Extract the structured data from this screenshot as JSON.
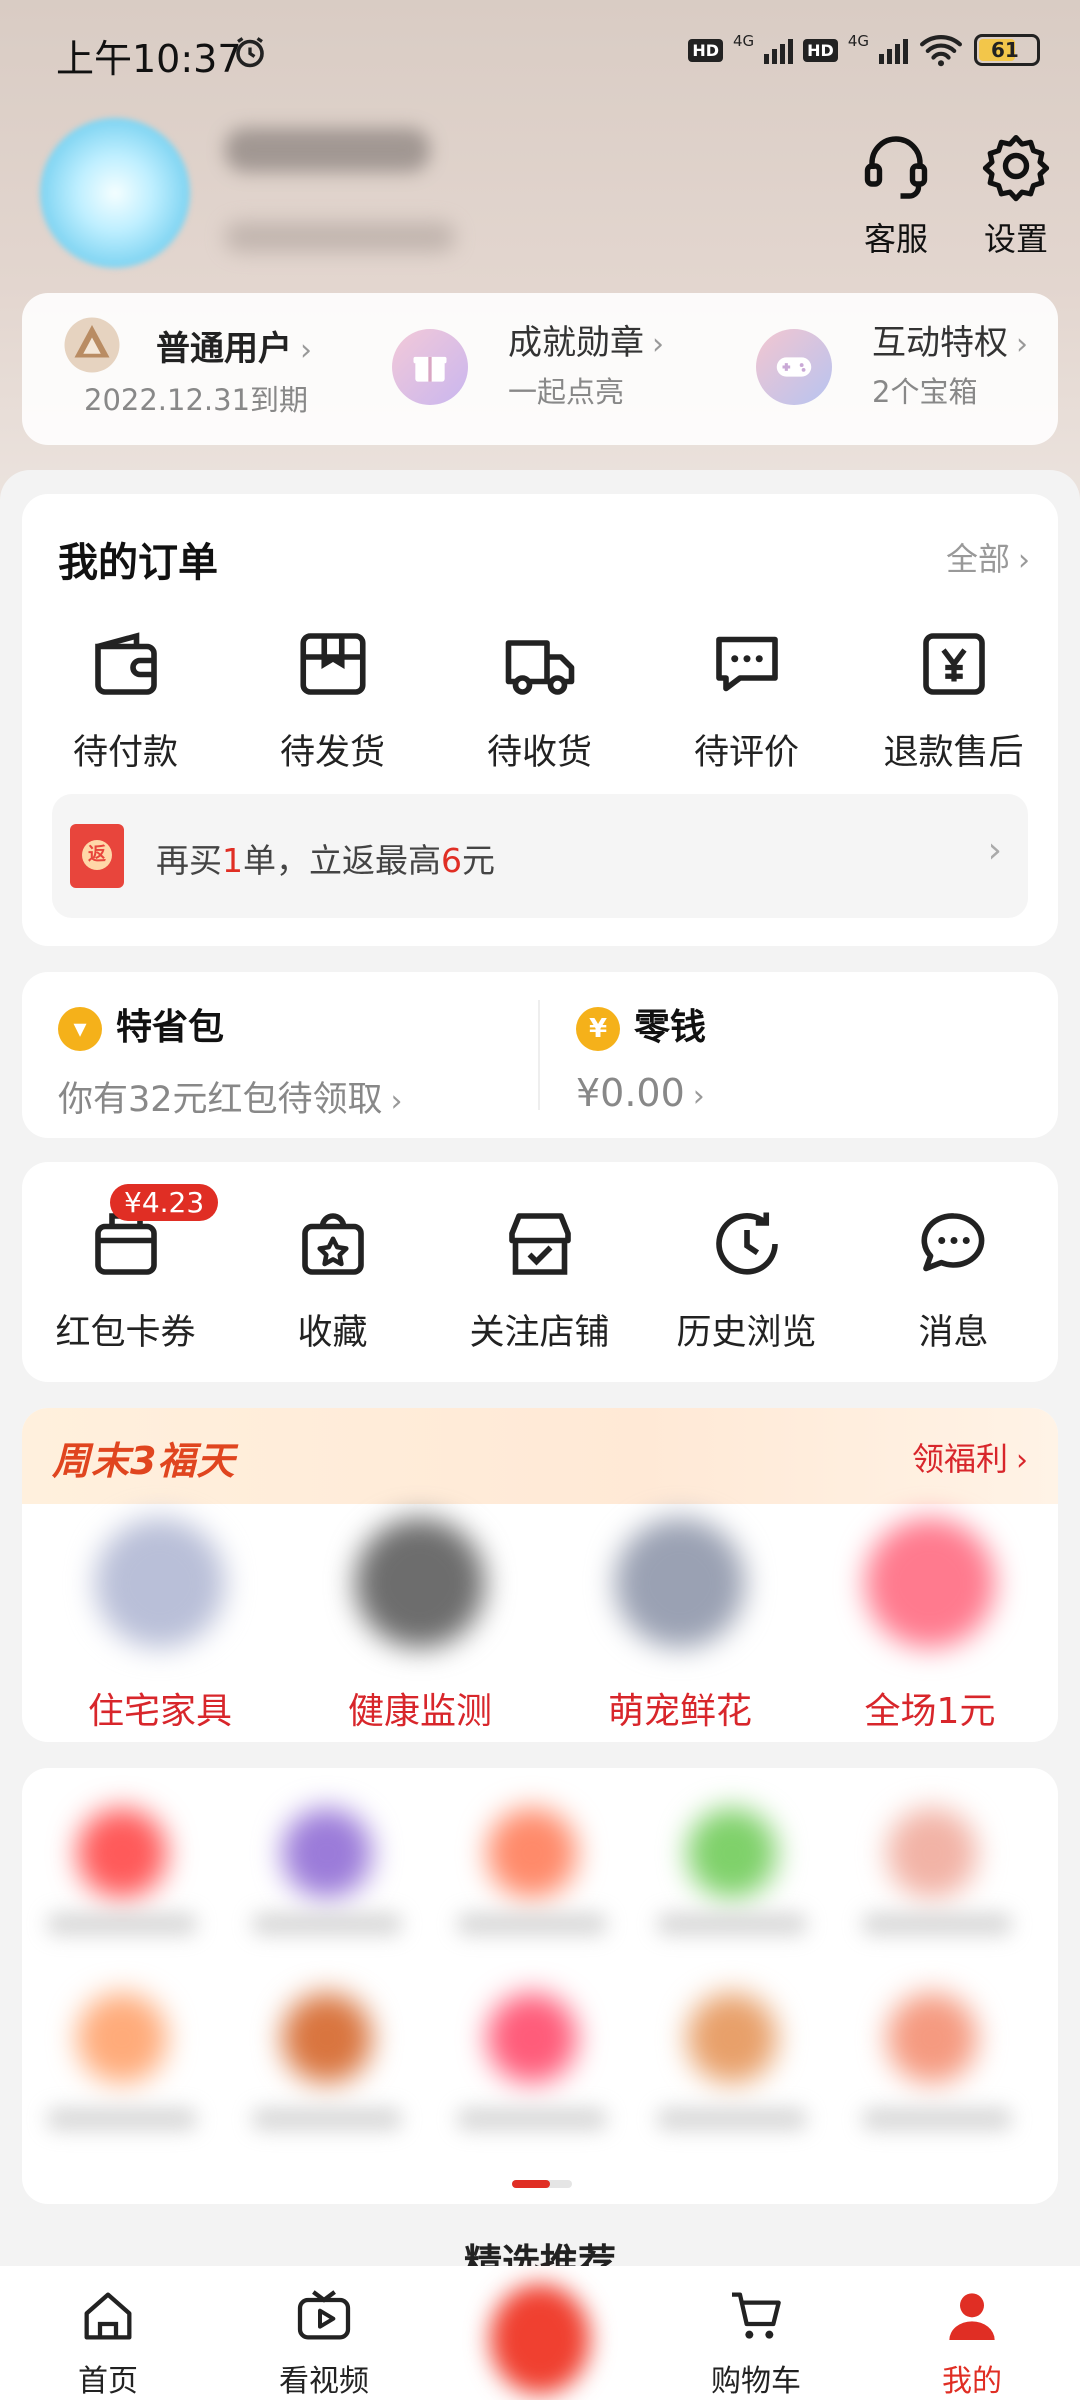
{
  "status_bar": {
    "time": "上午10:37",
    "hd1": "HD",
    "net1": "4G",
    "hd2": "HD",
    "net2": "4G",
    "battery": "61"
  },
  "header": {
    "service_label": "客服",
    "settings_label": "设置"
  },
  "membership": {
    "level_title": "普通用户",
    "level_sub": "2022.12.31到期",
    "medal_title": "成就勋章",
    "medal_sub": "一起点亮",
    "privilege_title": "互动特权",
    "privilege_sub": "2个宝箱"
  },
  "orders": {
    "title": "我的订单",
    "all_label": "全部",
    "items": [
      {
        "label": "待付款",
        "icon": "wallet-icon"
      },
      {
        "label": "待发货",
        "icon": "package-icon"
      },
      {
        "label": "待收货",
        "icon": "truck-icon"
      },
      {
        "label": "待评价",
        "icon": "comment-icon"
      },
      {
        "label": "退款售后",
        "icon": "refund-icon"
      }
    ],
    "promo": {
      "pre": "再买",
      "n1": "1",
      "mid": "单，立返最高",
      "n2": "6",
      "post": "元"
    }
  },
  "wallet": {
    "savings_title": "特省包",
    "savings_sub": "你有32元红包待领取",
    "change_title": "零钱",
    "change_value": "¥0.00"
  },
  "tools": {
    "badge": "¥4.23",
    "items": [
      {
        "label": "红包卡券",
        "icon": "coupon-icon"
      },
      {
        "label": "收藏",
        "icon": "favorite-bag-icon"
      },
      {
        "label": "关注店铺",
        "icon": "store-icon"
      },
      {
        "label": "历史浏览",
        "icon": "history-icon"
      },
      {
        "label": "消息",
        "icon": "message-icon"
      }
    ]
  },
  "fuli": {
    "title": "周末3福天",
    "link": "领福利",
    "items": [
      "住宅家具",
      "健康监测",
      "萌宠鲜花",
      "全场1元"
    ]
  },
  "recommend_title": "精选推荐",
  "bottom_nav": [
    {
      "label": "首页",
      "icon": "home-icon"
    },
    {
      "label": "看视频",
      "icon": "video-icon"
    },
    {
      "label": "",
      "icon": "center-promo-icon"
    },
    {
      "label": "购物车",
      "icon": "cart-icon"
    },
    {
      "label": "我的",
      "icon": "user-icon"
    }
  ],
  "colors": {
    "accent": "#e02e24",
    "coin": "#f5b11a"
  }
}
